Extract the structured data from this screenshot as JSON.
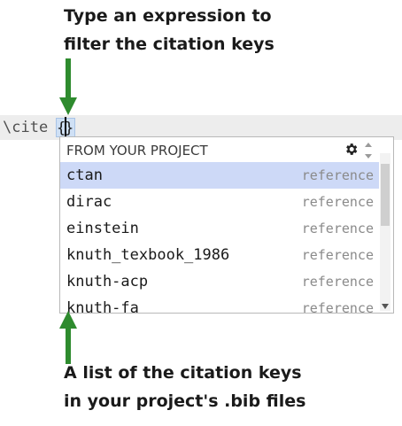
{
  "captions": {
    "top_line1": "Type an expression to",
    "top_line2": "filter the citation keys",
    "bottom_line1": "A list of the citation keys",
    "bottom_line2": "in your project's .bib files"
  },
  "editor": {
    "command": "\\cite",
    "open_brace": "{",
    "close_brace": "}"
  },
  "popup": {
    "header": "FROM YOUR PROJECT",
    "items": [
      {
        "key": "ctan",
        "type": "reference"
      },
      {
        "key": "dirac",
        "type": "reference"
      },
      {
        "key": "einstein",
        "type": "reference"
      },
      {
        "key": "knuth_texbook_1986",
        "type": "reference"
      },
      {
        "key": "knuth-acp",
        "type": "reference"
      },
      {
        "key": "knuth-fa",
        "type": "reference"
      }
    ],
    "selected_index": 0
  },
  "colors": {
    "arrow": "#2e8b2e",
    "selection": "#cdd9f7",
    "editor_bg": "#ededed"
  },
  "icons": {
    "gear": "gear-icon",
    "sort": "sort-arrows-icon"
  }
}
